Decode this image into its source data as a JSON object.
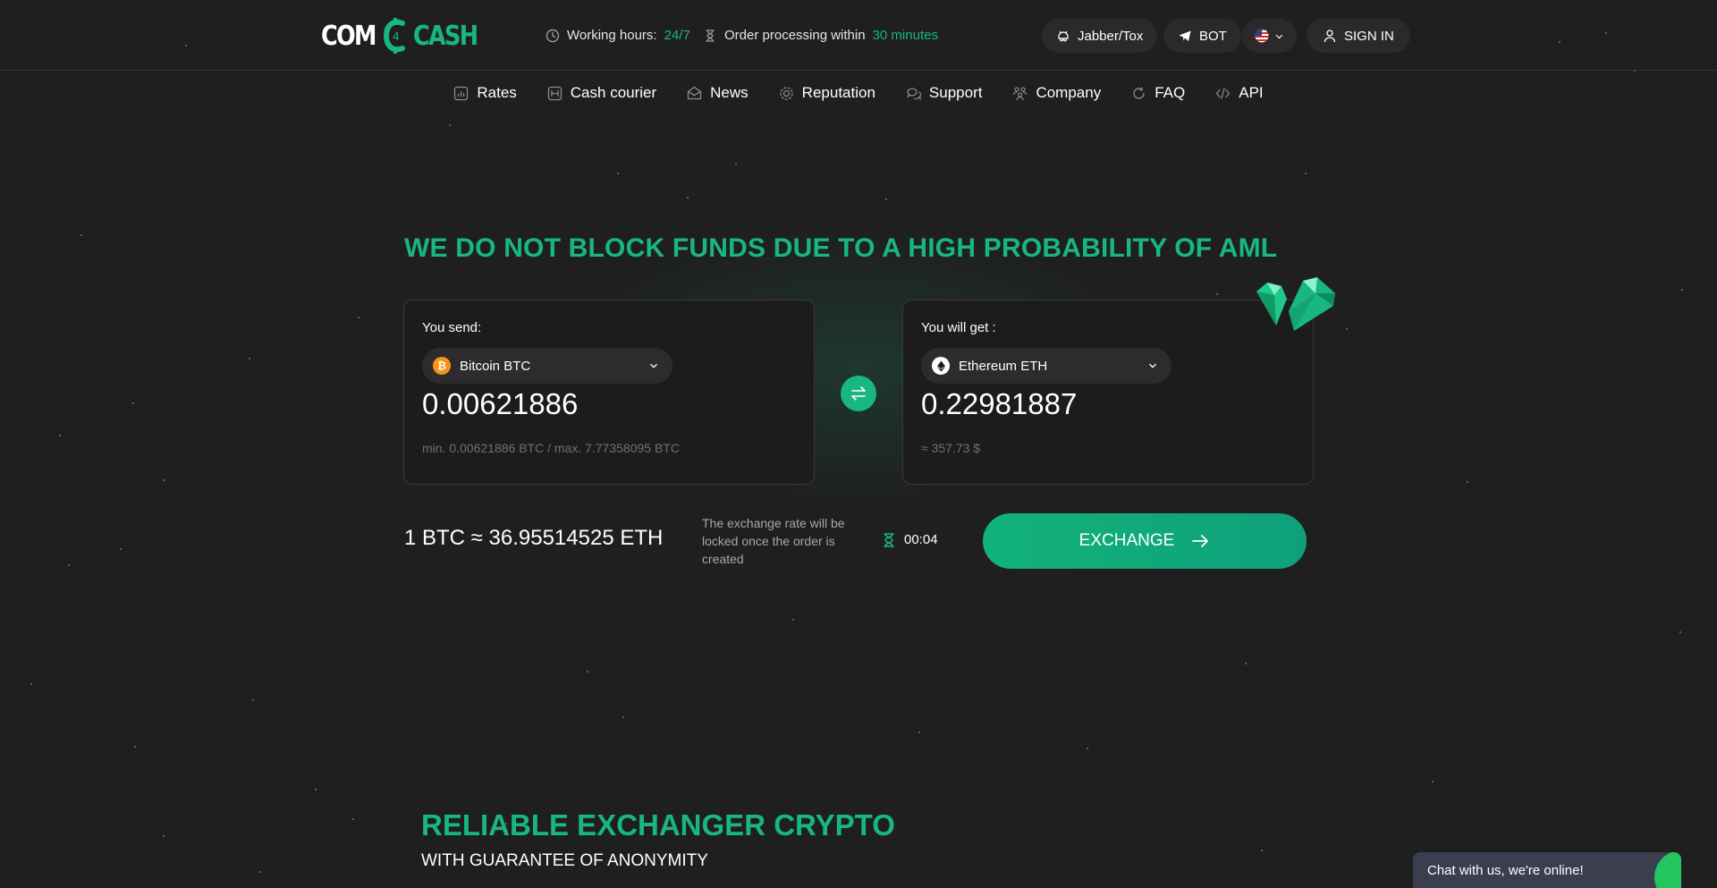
{
  "header": {
    "logo": {
      "left": "COM",
      "mark": "4",
      "right": "CASH"
    },
    "working_hours": {
      "label": "Working hours:",
      "value": "24/7"
    },
    "processing": {
      "label": "Order processing within",
      "value": "30 minutes"
    },
    "jabber_label": "Jabber/Tox",
    "bot_label": "BOT",
    "sign_in_label": "SIGN IN"
  },
  "nav": {
    "items": [
      {
        "label": "Rates",
        "icon": "chart-icon"
      },
      {
        "label": "Cash courier",
        "icon": "courier-icon"
      },
      {
        "label": "News",
        "icon": "news-icon"
      },
      {
        "label": "Reputation",
        "icon": "reputation-icon"
      },
      {
        "label": "Support",
        "icon": "support-icon"
      },
      {
        "label": "Company",
        "icon": "company-icon"
      },
      {
        "label": "FAQ",
        "icon": "faq-icon"
      },
      {
        "label": "API",
        "icon": "code-icon"
      }
    ]
  },
  "hero": {
    "headline": "WE DO NOT BLOCK FUNDS DUE TO A HIGH PROBABILITY OF AML",
    "send": {
      "label": "You send:",
      "currency": "Bitcoin BTC",
      "amount": "0.00621886",
      "limits": "min. 0.00621886 BTC / max. 7.77358095 BTC"
    },
    "get": {
      "label": "You will get :",
      "currency": "Ethereum ETH",
      "amount": "0.22981887",
      "approx": "≈ 357.73 $"
    },
    "rate": "1 BTC ≈ 36.95514525 ETH",
    "lock_note": "The exchange rate will be locked once the order is created",
    "timer": "00:04",
    "exchange_label": "EXCHANGE"
  },
  "section": {
    "title": "RELIABLE EXCHANGER CRYPTO",
    "subtitle": "WITH GUARANTEE OF ANONYMITY"
  },
  "chat": {
    "label": "Chat with us, we're online!"
  },
  "colors": {
    "accent": "#18b77f",
    "background": "#1f1f20",
    "card": "#1c1c1d",
    "btc": "#f7931a"
  }
}
